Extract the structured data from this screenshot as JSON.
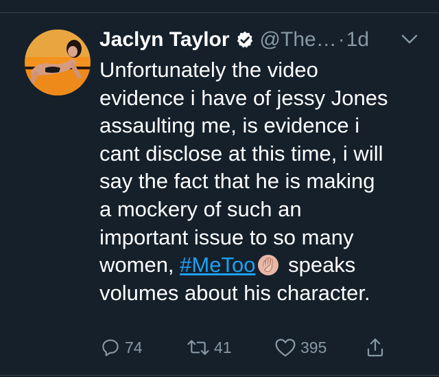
{
  "tweet": {
    "author": {
      "display_name": "Jaclyn Taylor",
      "handle": "@The…",
      "verified": true
    },
    "separator": "·",
    "time": "1d",
    "text_lines": [
      "Unfortunately the video",
      "evidence i have of jessy Jones",
      "assaulting me, is evidence i",
      "cant disclose at this time, i will",
      "say the fact that he is making",
      "a mockery of such an",
      "important issue to so many"
    ],
    "line8_before": "women, ",
    "hashtag": "#MeToo",
    "line8_after": " speaks",
    "line9": "volumes about his character."
  },
  "actions": {
    "reply_count": "74",
    "retweet_count": "41",
    "like_count": "395"
  },
  "colors": {
    "background": "#15202b",
    "text": "#ffffff",
    "secondary": "#8899a6",
    "accent": "#1da1f2",
    "divider": "#38444d",
    "avatar_bg": "#f3921e"
  },
  "icons": {
    "verified": "verified-badge-icon",
    "menu": "chevron-down-icon",
    "reply": "reply-icon",
    "retweet": "retweet-icon",
    "like": "heart-icon",
    "share": "share-icon",
    "emoji": "raised-hand-emoji"
  }
}
